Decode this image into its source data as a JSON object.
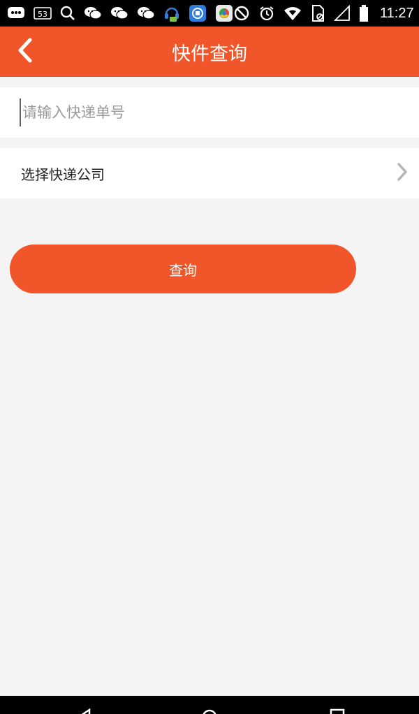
{
  "status_bar": {
    "notification_count": "53",
    "time": "11:27",
    "icons_left": [
      "chat-bubble-icon",
      "badge-53-icon",
      "search-icon",
      "wechat-icon",
      "wechat-icon",
      "wechat-icon",
      "headset-icon",
      "app-square-icon",
      "browser-icon"
    ],
    "icons_right": [
      "do-not-disturb-icon",
      "alarm-icon",
      "wifi-icon",
      "sim-card-icon",
      "cell-signal-icon",
      "battery-icon"
    ]
  },
  "app_bar": {
    "title": "快件查询",
    "back_icon": "chevron-left-icon"
  },
  "form": {
    "tracking_placeholder": "请输入快递单号",
    "tracking_value": "",
    "company_label": "选择快递公司",
    "company_arrow_icon": "chevron-right-icon",
    "query_button_label": "查询"
  },
  "colors": {
    "accent": "#f0562a",
    "background": "#f4f4f4",
    "row_bg": "#ffffff",
    "placeholder": "#9a9a9a",
    "chevron": "#b5b5b5"
  },
  "nav_bar": {
    "icons": [
      "back-icon",
      "home-icon",
      "recents-icon"
    ]
  }
}
